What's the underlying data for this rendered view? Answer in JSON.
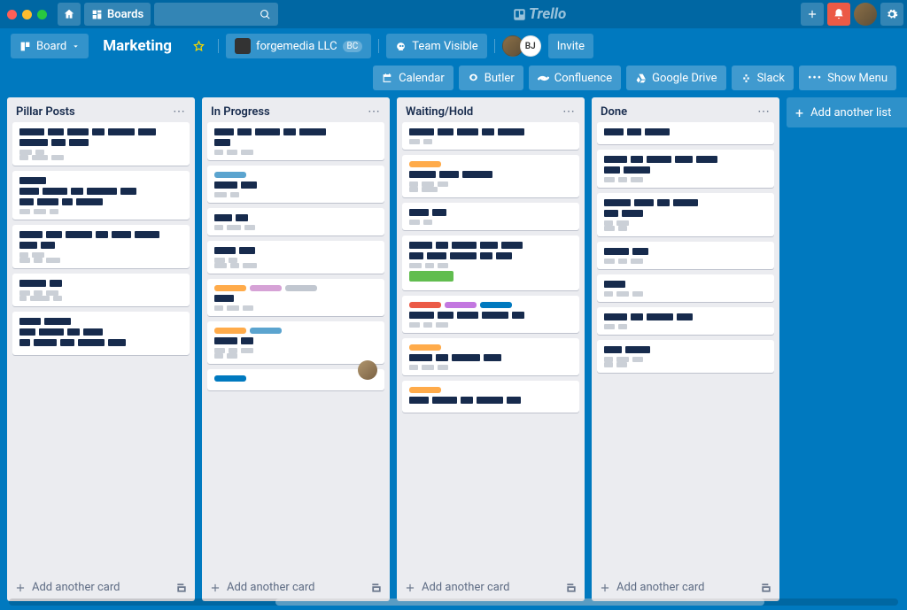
{
  "app": {
    "name": "Trello"
  },
  "topnav": {
    "boards_label": "Boards",
    "search_placeholder": ""
  },
  "board_header": {
    "view_toggle": "Board",
    "board_name": "Marketing",
    "team_name": "forgemedia LLC",
    "team_badge": "BC",
    "visibility": "Team Visible",
    "invite_label": "Invite",
    "members": [
      {
        "initials": ""
      },
      {
        "initials": "BJ"
      }
    ]
  },
  "powerups": [
    {
      "icon": "calendar",
      "label": "Calendar"
    },
    {
      "icon": "butler",
      "label": "Butler"
    },
    {
      "icon": "confluence",
      "label": "Confluence"
    },
    {
      "icon": "google-drive",
      "label": "Google Drive"
    },
    {
      "icon": "slack",
      "label": "Slack"
    },
    {
      "icon": "dots",
      "label": "Show Menu"
    }
  ],
  "lists": [
    {
      "title": "Pillar Posts",
      "cards": [
        {
          "labels": [],
          "lines": [
            [
              28,
              18,
              24,
              14,
              30,
              20
            ],
            [
              32,
              16,
              22
            ]
          ],
          "sub": [
            [
              14,
              10
            ],
            [
              10,
              18,
              14
            ]
          ]
        },
        {
          "labels": [],
          "lines": [
            [
              30
            ],
            [
              22,
              28,
              14,
              34,
              18
            ],
            [
              16,
              24,
              12,
              30
            ]
          ],
          "sub": [
            [
              12,
              14,
              10
            ]
          ]
        },
        {
          "labels": [],
          "lines": [
            [
              26,
              18,
              30,
              14,
              22,
              28
            ],
            [
              20,
              16
            ]
          ],
          "sub": [
            [
              10,
              14
            ],
            [
              12,
              10,
              16
            ]
          ]
        },
        {
          "labels": [],
          "lines": [
            [
              30,
              14
            ]
          ],
          "sub": [
            [
              12,
              10,
              14
            ],
            [
              8,
              22,
              10
            ]
          ]
        },
        {
          "labels": [],
          "lines": [
            [
              24,
              30
            ],
            [
              18,
              28,
              14,
              22
            ],
            [
              12,
              26,
              16,
              30,
              20
            ]
          ],
          "sub": []
        }
      ]
    },
    {
      "title": "In Progress",
      "cards": [
        {
          "labels": [],
          "lines": [
            [
              22,
              16,
              28,
              14,
              30
            ],
            [
              18
            ]
          ],
          "sub": [
            [
              10,
              12,
              14
            ]
          ]
        },
        {
          "labels": [
            "#5ba4cf"
          ],
          "lines": [
            [
              26,
              18
            ]
          ],
          "sub": [
            [
              14,
              10
            ]
          ]
        },
        {
          "labels": [],
          "lines": [
            [
              20,
              14
            ]
          ],
          "sub": [
            [
              10,
              16,
              12
            ]
          ]
        },
        {
          "labels": [],
          "lines": [
            [
              24,
              18
            ]
          ],
          "sub": [
            [
              12,
              10
            ],
            [
              14,
              10,
              16
            ]
          ]
        },
        {
          "labels": [
            "#ffab4a",
            "#d6a2d6",
            "#c1c7d0"
          ],
          "lines": [
            [
              22
            ]
          ],
          "sub": [
            [
              10,
              14,
              12
            ]
          ]
        },
        {
          "labels": [
            "#ffab4a",
            "#5ba4cf"
          ],
          "lines": [
            [
              26,
              14
            ]
          ],
          "sub": [
            [
              12,
              10,
              14
            ],
            [
              10,
              12
            ]
          ],
          "avatar": true
        },
        {
          "labels": [
            "#0079bf"
          ],
          "lines": [
            []
          ],
          "sub": []
        }
      ]
    },
    {
      "title": "Waiting/Hold",
      "cards": [
        {
          "labels": [],
          "lines": [
            [
              28,
              18,
              24,
              14,
              30
            ]
          ],
          "sub": [
            [
              12,
              10
            ]
          ]
        },
        {
          "labels": [
            "#ffab4a"
          ],
          "lines": [
            [
              30,
              22,
              34
            ]
          ],
          "sub": [
            [
              10,
              14,
              12
            ],
            [
              10,
              18
            ]
          ]
        },
        {
          "labels": [],
          "lines": [
            [
              22,
              16
            ]
          ],
          "sub": [
            [
              12,
              10
            ]
          ]
        },
        {
          "labels": [],
          "lines": [
            [
              26,
              14,
              28,
              20,
              24
            ],
            [
              16,
              22,
              30,
              14,
              18
            ]
          ],
          "sub": [
            [
              14,
              10,
              12
            ]
          ],
          "green": true
        },
        {
          "labels": [
            "#eb5a46",
            "#c377e0",
            "#0079bf"
          ],
          "lines": [
            [
              28,
              18,
              24,
              30,
              14
            ]
          ],
          "sub": [
            [
              12,
              10,
              14
            ]
          ]
        },
        {
          "labels": [
            "#ffab4a"
          ],
          "lines": [
            [
              26,
              14,
              32,
              20
            ]
          ],
          "sub": [
            [
              10,
              14,
              12
            ]
          ]
        },
        {
          "labels": [
            "#ffab4a"
          ],
          "lines": [
            [
              22,
              28,
              14,
              30,
              16
            ]
          ],
          "sub": []
        }
      ]
    },
    {
      "title": "Done",
      "cards": [
        {
          "labels": [],
          "lines": [
            [
              22,
              16,
              28
            ]
          ],
          "sub": []
        },
        {
          "labels": [],
          "lines": [
            [
              26,
              14,
              28,
              20,
              24
            ],
            [
              18,
              30
            ]
          ],
          "sub": [
            [
              12,
              10,
              14
            ]
          ]
        },
        {
          "labels": [],
          "lines": [
            [
              30,
              22,
              14,
              28
            ],
            [
              16,
              24
            ]
          ],
          "sub": [
            [
              10,
              14
            ],
            [
              12,
              10
            ]
          ]
        },
        {
          "labels": [],
          "lines": [
            [
              28,
              18
            ]
          ],
          "sub": [
            [
              12,
              10,
              14
            ]
          ]
        },
        {
          "labels": [],
          "lines": [
            [
              24
            ]
          ],
          "sub": [
            [
              10,
              14,
              12
            ]
          ]
        },
        {
          "labels": [],
          "lines": [
            [
              26,
              14,
              30,
              18
            ]
          ],
          "sub": [
            [
              12,
              10
            ]
          ]
        },
        {
          "labels": [],
          "lines": [
            [
              20,
              28
            ]
          ],
          "sub": [
            [
              10,
              14,
              12
            ],
            [
              10,
              12
            ]
          ]
        }
      ]
    }
  ],
  "add_card_label": "Add another card",
  "add_list_label": "Add another list"
}
